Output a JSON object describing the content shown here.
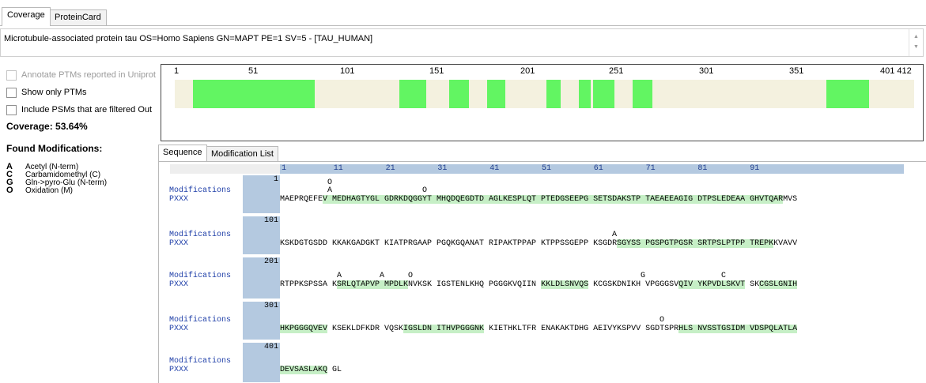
{
  "top_tabs": [
    "Coverage",
    "ProteinCard"
  ],
  "header": {
    "text": "Microtubule-associated protein tau OS=Homo Sapiens GN=MAPT PE=1 SV=5 - [TAU_HUMAN]"
  },
  "options": [
    {
      "label": "Annotate PTMs reported in Uniprot",
      "checked": false,
      "enabled": false
    },
    {
      "label": "Show only PTMs",
      "checked": false,
      "enabled": true
    },
    {
      "label": "Include PSMs that are filtered Out",
      "checked": false,
      "enabled": true
    }
  ],
  "coverage_text": "Coverage:  53.64%",
  "found_label": "Found Modifications:",
  "modifications": [
    {
      "code": "A",
      "name": "Acetyl (N-term)"
    },
    {
      "code": "C",
      "name": "Carbamidomethyl (C)"
    },
    {
      "code": "G",
      "name": "Gln->pyro-Glu (N-term)"
    },
    {
      "code": "O",
      "name": "Oxidation (M)"
    }
  ],
  "overview": {
    "labels": [
      "1",
      "51",
      "101",
      "151",
      "201",
      "251",
      "301",
      "351",
      "401 412"
    ],
    "length": 412,
    "covered_ranges": [
      [
        11,
        78
      ],
      [
        126,
        140
      ],
      [
        154,
        164
      ],
      [
        175,
        184
      ],
      [
        208,
        215
      ],
      [
        226,
        232
      ],
      [
        234,
        245
      ],
      [
        256,
        266
      ],
      [
        364,
        387
      ]
    ],
    "colors": {
      "covered": "#62f562",
      "uncovered": "#f4f1df",
      "border": "#4a4a4a"
    }
  },
  "sub_tabs": [
    "Sequence",
    "Modification List"
  ],
  "ruler_ticks": [
    "1",
    "11",
    "21",
    "31",
    "41",
    "51",
    "61",
    "71",
    "81",
    "91"
  ],
  "row_labels": {
    "mod": "Modifications",
    "seq": "PXXX"
  },
  "blocks": [
    {
      "num": "1",
      "markers": [
        {
          "line": 0,
          "col": 10,
          "ch": "O"
        },
        {
          "line": 1,
          "col": 10,
          "ch": "A"
        },
        {
          "line": 1,
          "col": 30,
          "ch": "O"
        }
      ],
      "segments": [
        {
          "t": "MAEPRQEFE",
          "h": false
        },
        {
          "t": "V MEDHAGTYGL GDRKDQGGYT MHQDQEGDTD AGLKESPLQT PTEDGSEEPG SETSDAKSTP TAEAEEAGIG DTPSLEDEAA GHVTQAR",
          "h": true
        },
        {
          "t": "MVS",
          "h": false
        }
      ]
    },
    {
      "num": "101",
      "markers": [
        {
          "line": 1,
          "col": 70,
          "ch": "A"
        }
      ],
      "segments": [
        {
          "t": "KSKDGTGSDD KKAKGADGKT KIATPRGAAP PGQKGQANAT RIPAKTPPAP KTPPSSGEPP KSGDR",
          "h": false
        },
        {
          "t": "SGYSS PGSPGTPGSR SRTPSLPTPP TREPK",
          "h": true
        },
        {
          "t": "KVAVV",
          "h": false
        }
      ]
    },
    {
      "num": "201",
      "markers": [
        {
          "line": 1,
          "col": 12,
          "ch": "A"
        },
        {
          "line": 1,
          "col": 21,
          "ch": "A"
        },
        {
          "line": 1,
          "col": 27,
          "ch": "O"
        },
        {
          "line": 1,
          "col": 76,
          "ch": "G"
        },
        {
          "line": 1,
          "col": 93,
          "ch": "C"
        }
      ],
      "segments": [
        {
          "t": "RTPPKSPSSA K",
          "h": false
        },
        {
          "t": "SRLQTAPVP MPDLK",
          "h": true
        },
        {
          "t": "NVKSK IGSTENLKHQ PGGGKVQIIN ",
          "h": false
        },
        {
          "t": "KKLDLSNVQS",
          "h": true
        },
        {
          "t": " KCGSKDNIKH VPGGGSV",
          "h": false
        },
        {
          "t": "QIV YKPVDLSKVT",
          "h": true
        },
        {
          "t": " SK",
          "h": false
        },
        {
          "t": "CGSLGNIH",
          "h": true
        }
      ]
    },
    {
      "num": "301",
      "markers": [
        {
          "line": 1,
          "col": 80,
          "ch": "O"
        }
      ],
      "segments": [
        {
          "t": "HKPGGGQVEV",
          "h": true
        },
        {
          "t": " KSEKLDFKDR VQSK",
          "h": false
        },
        {
          "t": "IGSLDN ITHVPGGGNK",
          "h": true
        },
        {
          "t": " KIETHKLTFR ENAKAKTDHG AEIVYKSPVV SGDTSPR",
          "h": false
        },
        {
          "t": "HLS NVSSTGSIDM VDSPQLATLA",
          "h": true
        }
      ]
    },
    {
      "num": "401",
      "markers": [],
      "segments": [
        {
          "t": "DEVSASLAKQ",
          "h": true
        },
        {
          "t": " GL",
          "h": false
        }
      ]
    }
  ]
}
